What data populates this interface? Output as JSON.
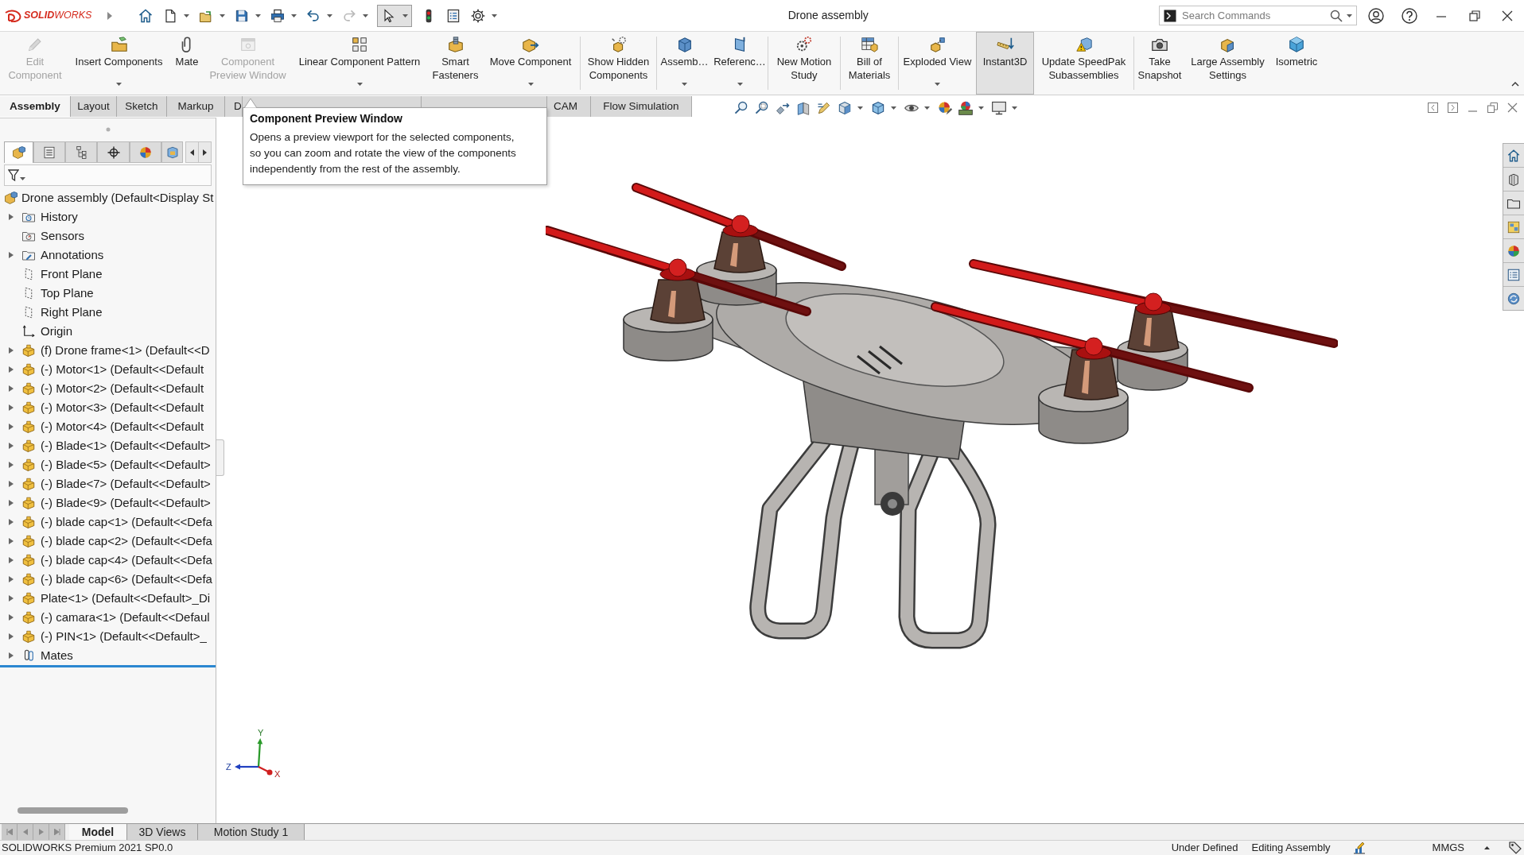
{
  "title_bar": {
    "logo": "**SOLID**WORKS",
    "title": "Drone assembly",
    "search": {
      "placeholder": "Search Commands"
    }
  },
  "quick_access": [
    {
      "dropdown": false,
      "disabled": false,
      "pressed": false
    },
    {
      "dropdown": true,
      "disabled": false,
      "pressed": false
    },
    {
      "dropdown": true,
      "disabled": false,
      "pressed": false
    },
    {
      "dropdown": true,
      "disabled": false,
      "pressed": false
    },
    {
      "dropdown": true,
      "disabled": false,
      "pressed": false
    },
    {
      "dropdown": true,
      "disabled": false,
      "pressed": false
    },
    {
      "dropdown": true,
      "disabled": true,
      "pressed": false
    },
    {
      "dropdown": true,
      "disabled": false,
      "pressed": true
    },
    {
      "dropdown": false,
      "disabled": false,
      "pressed": false
    },
    {
      "dropdown": false,
      "disabled": false,
      "pressed": false
    },
    {
      "dropdown": true,
      "disabled": false,
      "pressed": false
    }
  ],
  "command_manager": {
    "groups": [
      [
        {
          "label": "Edit\nComponent",
          "disabled": true,
          "dropdown": false,
          "active": false
        },
        {
          "label": "Insert Components",
          "disabled": false,
          "dropdown": true,
          "active": false
        },
        {
          "label": "Mate",
          "disabled": false,
          "dropdown": false,
          "active": false
        },
        {
          "label": "Component\nPreview Window",
          "disabled": true,
          "dropdown": false,
          "active": false
        },
        {
          "label": "Linear Component Pattern",
          "disabled": false,
          "dropdown": true,
          "active": false
        },
        {
          "label": "Smart\nFasteners",
          "disabled": false,
          "dropdown": false,
          "active": false
        },
        {
          "label": "Move Component",
          "disabled": false,
          "dropdown": true,
          "active": false
        }
      ],
      [
        {
          "label": "Show Hidden\nComponents",
          "disabled": false,
          "dropdown": false,
          "active": false
        }
      ],
      [
        {
          "label": "Assemb…",
          "disabled": false,
          "dropdown": true,
          "active": false
        },
        {
          "label": "Referenc…",
          "disabled": false,
          "dropdown": true,
          "active": false
        }
      ],
      [
        {
          "label": "New Motion\nStudy",
          "disabled": false,
          "dropdown": false,
          "active": false
        }
      ],
      [
        {
          "label": "Bill of\nMaterials",
          "disabled": false,
          "dropdown": false,
          "active": false
        }
      ],
      [
        {
          "label": "Exploded View",
          "disabled": false,
          "dropdown": true,
          "active": false
        },
        {
          "label": "Instant3D",
          "disabled": false,
          "dropdown": false,
          "active": true
        },
        {
          "label": "Update SpeedPak\nSubassemblies",
          "disabled": false,
          "dropdown": false,
          "active": false
        }
      ],
      [
        {
          "label": "Take\nSnapshot",
          "disabled": false,
          "dropdown": false,
          "active": false
        },
        {
          "label": "Large Assembly\nSettings",
          "disabled": false,
          "dropdown": false,
          "active": false
        },
        {
          "label": "Isometric",
          "disabled": false,
          "dropdown": false,
          "active": false
        }
      ]
    ]
  },
  "tabs": [
    {
      "label": "Assembly",
      "selected": true
    },
    {
      "label": "Layout",
      "selected": false
    },
    {
      "label": "Sketch",
      "selected": false
    },
    {
      "label": "Markup",
      "selected": false
    },
    {
      "label": "D",
      "selected": false
    },
    {
      "selected": false
    },
    {
      "selected": false
    },
    {
      "label": "CAM",
      "selected": false
    },
    {
      "label": "Flow Simulation",
      "selected": false
    }
  ],
  "tooltip": {
    "title": "Component Preview Window",
    "text": "Opens a preview viewport for the selected components, so you can zoom and rotate the view of the components independently from the rest of the assembly."
  },
  "feature_manager": {
    "tabs": [
      {
        "selected": true
      },
      {
        "selected": false
      },
      {
        "selected": false
      },
      {
        "selected": false
      },
      {
        "selected": false
      },
      {
        "selected": false
      }
    ],
    "tree": {
      "label": "Drone assembly (Default<Display St",
      "kind": "assembly",
      "children": [
        {
          "label": "History",
          "kind": "history",
          "expanded": false
        },
        {
          "label": "Sensors",
          "kind": "sensors"
        },
        {
          "label": "Annotations",
          "kind": "annotations",
          "expanded": false
        },
        {
          "label": "Front Plane",
          "kind": "plane"
        },
        {
          "label": "Top Plane",
          "kind": "plane"
        },
        {
          "label": "Right Plane",
          "kind": "plane"
        },
        {
          "label": "Origin",
          "kind": "origin"
        },
        {
          "label": "(f) Drone frame<1> (Default<<D",
          "kind": "part",
          "expanded": false
        },
        {
          "label": "(-) Motor<1> (Default<<Default",
          "kind": "part",
          "expanded": false
        },
        {
          "label": "(-) Motor<2> (Default<<Default",
          "kind": "part",
          "expanded": false
        },
        {
          "label": "(-) Motor<3> (Default<<Default",
          "kind": "part",
          "expanded": false
        },
        {
          "label": "(-) Motor<4> (Default<<Default",
          "kind": "part",
          "expanded": false
        },
        {
          "label": "(-) Blade<1> (Default<<Default>",
          "kind": "part",
          "expanded": false
        },
        {
          "label": "(-) Blade<5> (Default<<Default>",
          "kind": "part",
          "expanded": false
        },
        {
          "label": "(-) Blade<7> (Default<<Default>",
          "kind": "part",
          "expanded": false
        },
        {
          "label": "(-) Blade<9> (Default<<Default>",
          "kind": "part",
          "expanded": false
        },
        {
          "label": "(-) blade cap<1> (Default<<Defa",
          "kind": "part",
          "expanded": false
        },
        {
          "label": "(-) blade cap<2> (Default<<Defa",
          "kind": "part",
          "expanded": false
        },
        {
          "label": "(-) blade cap<4> (Default<<Defa",
          "kind": "part",
          "expanded": false
        },
        {
          "label": "(-) blade cap<6> (Default<<Defa",
          "kind": "part",
          "expanded": false
        },
        {
          "label": "Plate<1> (Default<<Default>_Di",
          "kind": "part",
          "expanded": false
        },
        {
          "label": "(-) camara<1> (Default<<Defaul",
          "kind": "part",
          "expanded": false
        },
        {
          "label": "(-) PIN<1> (Default<<Default>_",
          "kind": "part",
          "expanded": false
        },
        {
          "label": "Mates",
          "kind": "mates",
          "expanded": false
        }
      ]
    }
  },
  "viewport": {
    "axis_labels": {
      "y": "Y",
      "z": "Z",
      "x": "X"
    }
  },
  "bottom_tabs": [
    {
      "label": "Model",
      "selected": true
    },
    {
      "label": "3D Views",
      "selected": false
    },
    {
      "label": "Motion Study 1",
      "selected": false
    }
  ],
  "status_bar": {
    "product": "SOLIDWORKS Premium 2021 SP0.0",
    "state": "Under Defined",
    "mode": "Editing Assembly",
    "units": "MMGS"
  }
}
